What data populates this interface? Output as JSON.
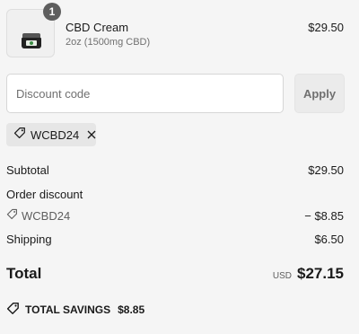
{
  "product": {
    "quantity": "1",
    "name": "CBD Cream",
    "variant": "2oz (1500mg CBD)",
    "price": "$29.50"
  },
  "discount": {
    "placeholder": "Discount code",
    "apply_label": "Apply",
    "applied_code": "WCBD24"
  },
  "summary": {
    "subtotal_label": "Subtotal",
    "subtotal_value": "$29.50",
    "order_discount_label": "Order discount",
    "discount_code": "WCBD24",
    "discount_value": "− $8.85",
    "shipping_label": "Shipping",
    "shipping_value": "$6.50",
    "total_label": "Total",
    "currency": "USD",
    "total_value": "$27.15"
  },
  "savings": {
    "label": "TOTAL SAVINGS",
    "value": "$8.85"
  }
}
